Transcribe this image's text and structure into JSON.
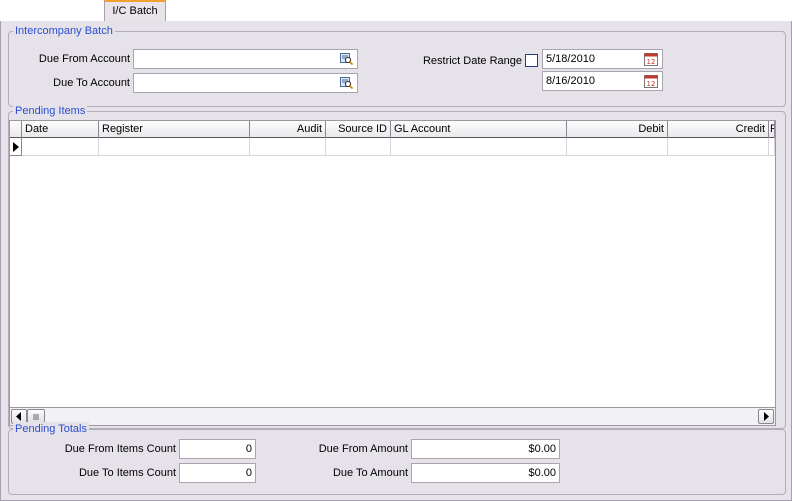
{
  "tab": {
    "label": "I/C Batch"
  },
  "intercompany_batch": {
    "title": "Intercompany Batch",
    "due_from_account": {
      "label": "Due From Account",
      "value": ""
    },
    "due_to_account": {
      "label": "Due To Account",
      "value": ""
    },
    "restrict_date_range": {
      "label": "Restrict Date Range",
      "checked": false
    },
    "date_from": "5/18/2010",
    "date_to": "8/16/2010"
  },
  "pending_items": {
    "title": "Pending Items",
    "columns": [
      "Date",
      "Register",
      "Audit",
      "Source ID",
      "GL Account",
      "Debit",
      "Credit",
      "F"
    ]
  },
  "pending_totals": {
    "title": "Pending Totals",
    "due_from_items_count": {
      "label": "Due From Items Count",
      "value": "0"
    },
    "due_to_items_count": {
      "label": "Due To Items Count",
      "value": "0"
    },
    "due_from_amount": {
      "label": "Due From Amount",
      "value": "$0.00"
    },
    "due_to_amount": {
      "label": "Due To Amount",
      "value": "$0.00"
    }
  },
  "icons": {
    "lookup": "lookup-icon",
    "calendar": "calendar-icon",
    "row_pointer": "row-pointer-icon",
    "scroll_left": "arrow-left-icon",
    "scroll_right": "arrow-right-icon"
  }
}
